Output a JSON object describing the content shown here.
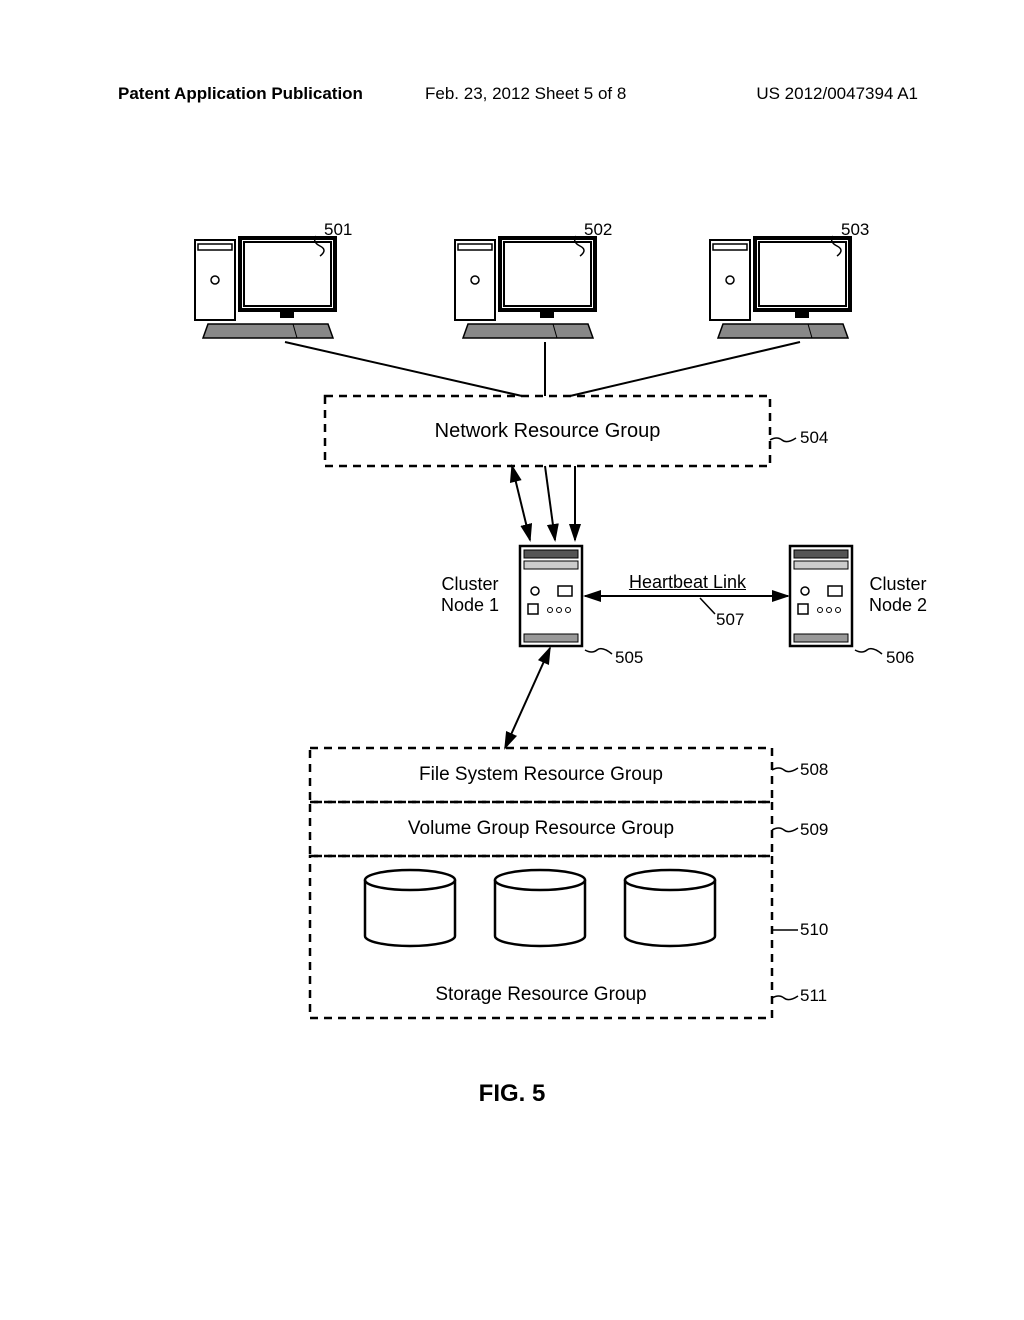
{
  "header": {
    "left": "Patent Application Publication",
    "mid": "Feb. 23, 2012  Sheet 5 of 8",
    "right": "US 2012/0047394 A1"
  },
  "labels": {
    "ref501": "501",
    "ref502": "502",
    "ref503": "503",
    "ref504": "504",
    "ref505": "505",
    "ref506": "506",
    "ref507": "507",
    "ref508": "508",
    "ref509": "509",
    "ref510": "510",
    "ref511": "511",
    "network_resource_group": "Network Resource Group",
    "cluster_node_1": "Cluster\nNode 1",
    "cluster_node_2": "Cluster\nNode 2",
    "heartbeat_link": "Heartbeat Link",
    "file_system_resource_group": "File System Resource Group",
    "volume_group_resource_group": "Volume Group Resource Group",
    "storage_resource_group": "Storage Resource Group"
  },
  "figure_caption": "FIG. 5"
}
